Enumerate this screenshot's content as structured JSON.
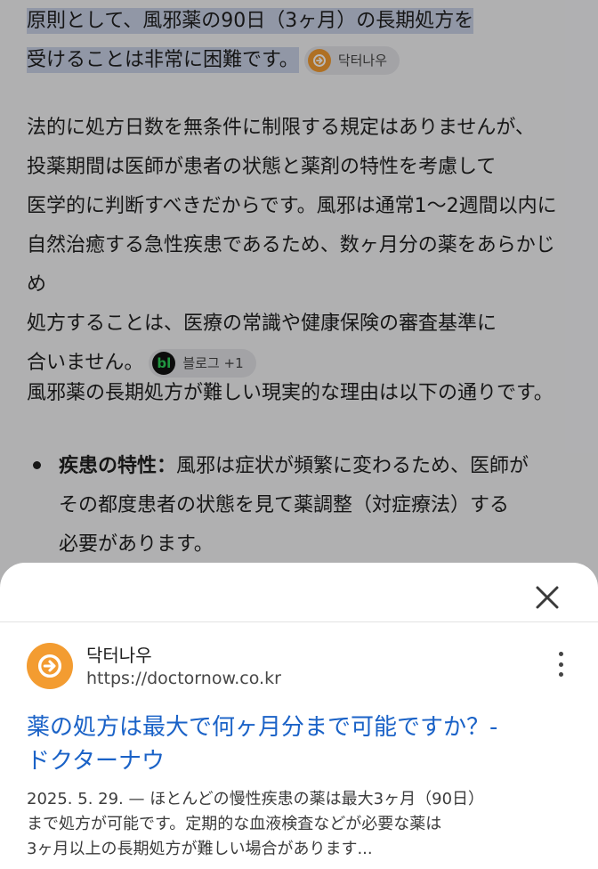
{
  "article": {
    "para1_highlight_line1": "原則として、風邪薬の90日（3ヶ月）の長期処方を",
    "para1_highlight_line2": "受けることは非常に困難です。",
    "para1_source_chip": "닥터나우",
    "para2_lines": [
      "法的に処方日数を無条件に制限する規定はありませんが、",
      "投薬期間は医師が患者の状態と薬剤の特性を考慮して",
      "医学的に判断すべきだからです。風邪は通常1～2週間以内に",
      "自然治癒する急性疾患であるため、数ヶ月分の薬をあらかじめ",
      "処方することは、医療の常識や健康保険の審査基準に"
    ],
    "para2_last_line": "合いません。",
    "para2_source_chip": "블로그 +1",
    "para2_chip_logo": "bl",
    "para3": "風邪薬の長期処方が難しい現実的な理由は以下の通りです。",
    "bullet1_title": "疾患の特性：",
    "bullet1_line1": "風邪は症状が頻繁に変わるため、医師が",
    "bullet1_line2": "その都度患者の状態を見て薬調整（対症療法）する",
    "bullet1_line3": "必要があります。"
  },
  "sheet": {
    "source_name": "닥터나우",
    "source_url": "https://doctornow.co.kr",
    "result_title_line1": "薬の処方は最大で何ヶ月分まで可能ですか？-",
    "result_title_line2": "ドクターナウ",
    "snippet_line1": "2025. 5. 29. — ほとんどの慢性疾患の薬は最大3ヶ月（90日）",
    "snippet_line2": "まで処方が可能です。定期的な血液検査などが必要な薬は",
    "snippet_line3": "3ヶ月以上の長期処方が難しい場合があります..."
  },
  "icons": {
    "close": "close-icon",
    "more": "more-vert-icon",
    "source_logo": "doctornow-logo-icon"
  },
  "colors": {
    "link": "#1a62c7",
    "highlight": "#c9d1e6",
    "doctornow_orange": "#f39c31"
  }
}
